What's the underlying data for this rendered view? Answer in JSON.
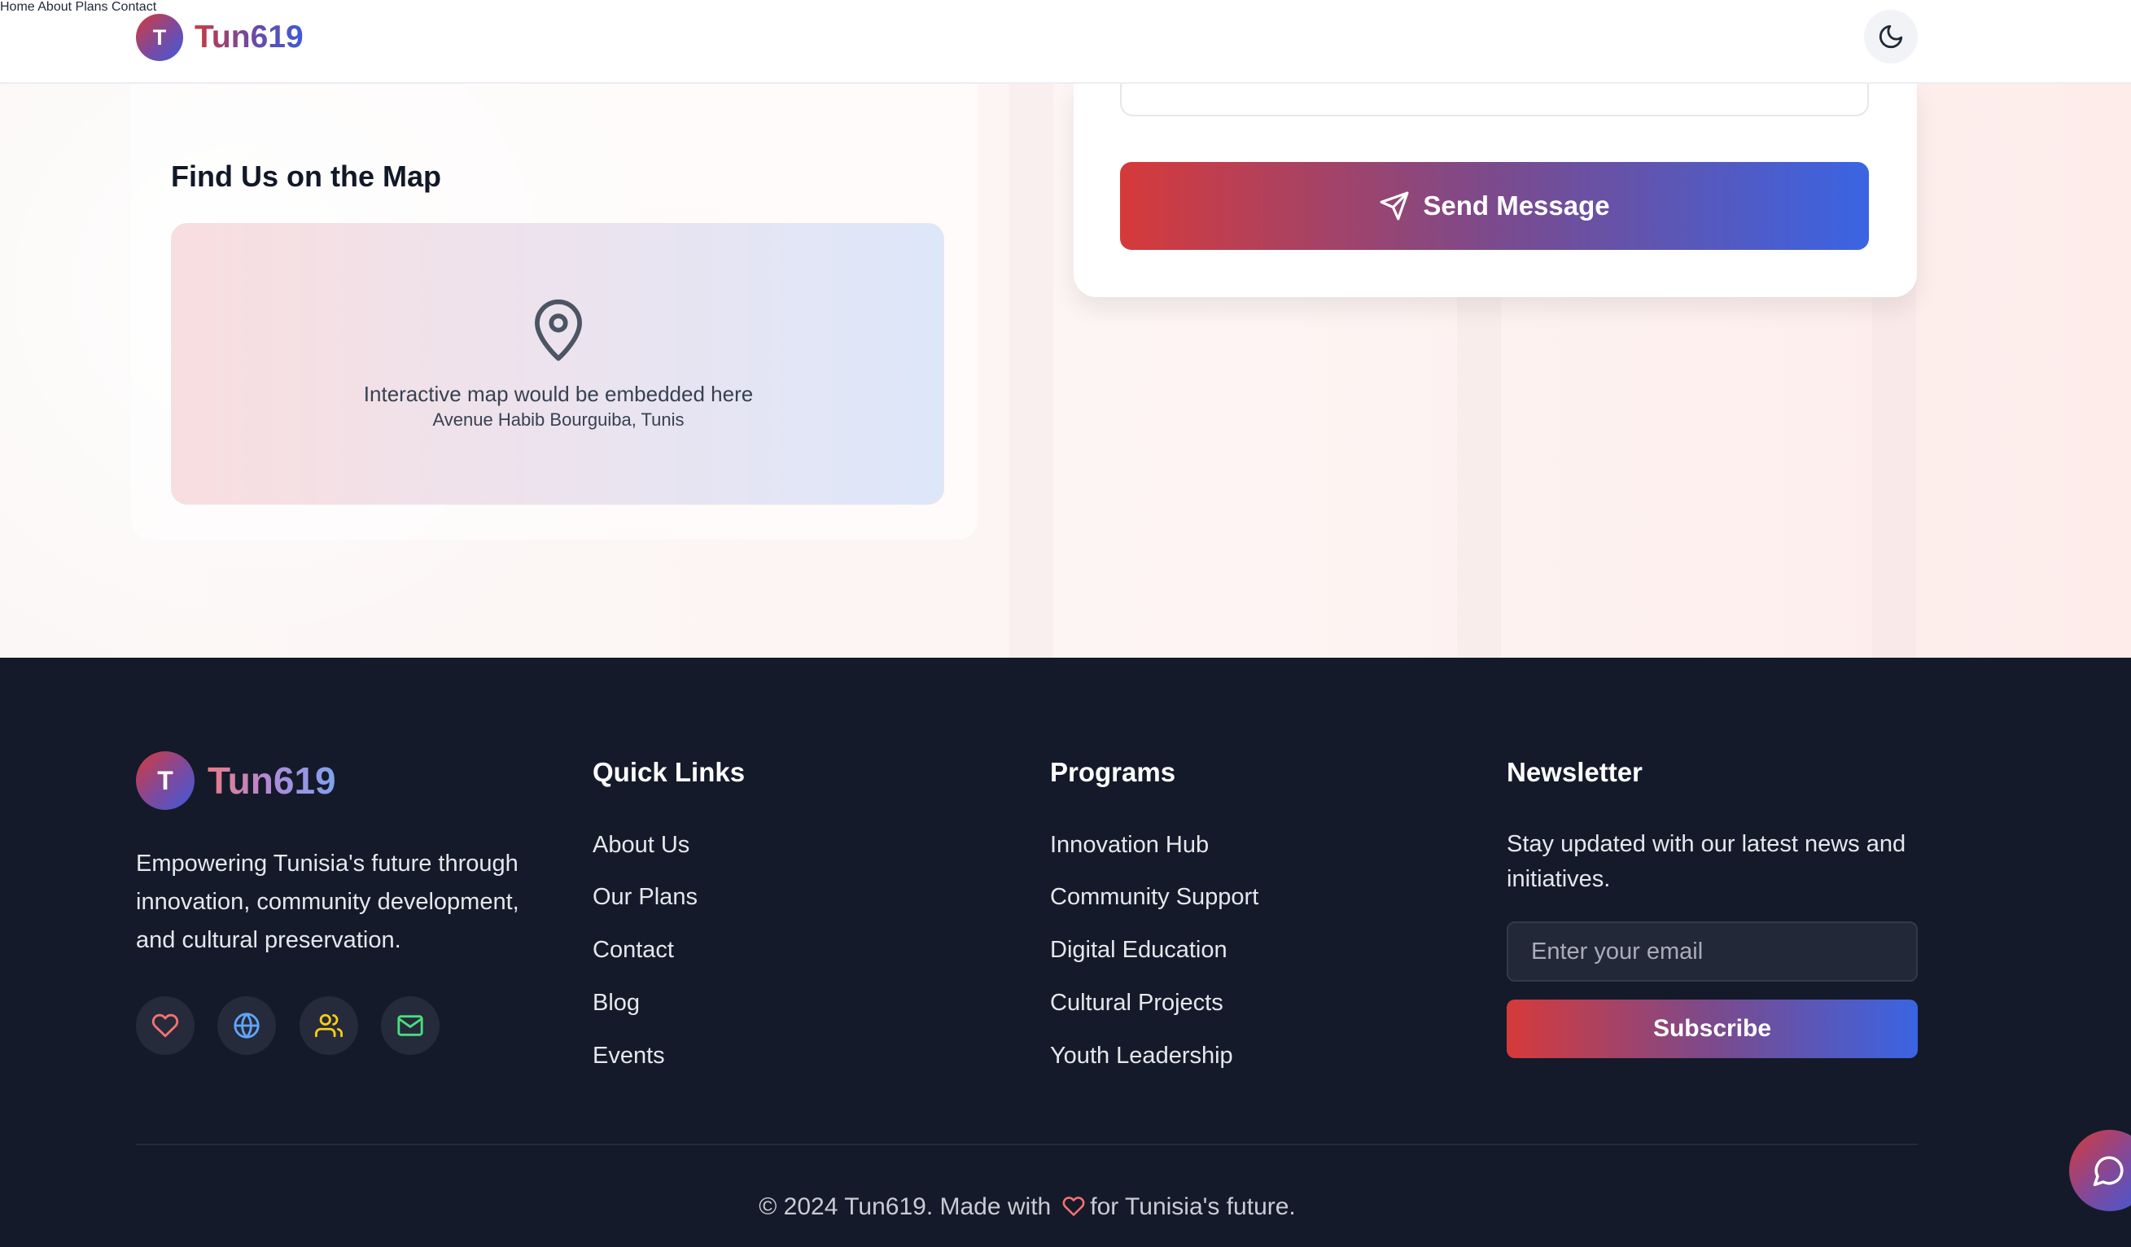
{
  "header": {
    "logo_letter": "T",
    "brand": "Tun619",
    "nav": [
      {
        "label": "Home"
      },
      {
        "label": "About"
      },
      {
        "label": "Plans"
      },
      {
        "label": "Contact"
      }
    ],
    "theme_toggle_icon": "moon-icon"
  },
  "map_section": {
    "heading": "Find Us on the Map",
    "pin_icon": "map-pin-icon",
    "placeholder_text": "Interactive map would be embedded here",
    "address": "Avenue Habib Bourguiba, Tunis"
  },
  "contact_form": {
    "send_label": "Send Message",
    "send_icon": "paper-plane-icon"
  },
  "footer": {
    "logo_letter": "T",
    "brand": "Tun619",
    "description": "Empowering Tunisia's future through innovation, community development, and cultural preservation.",
    "social": [
      {
        "icon": "heart-icon",
        "color": "#f87171"
      },
      {
        "icon": "globe-icon",
        "color": "#60a5fa"
      },
      {
        "icon": "users-icon",
        "color": "#facc15"
      },
      {
        "icon": "mail-icon",
        "color": "#4ade80"
      }
    ],
    "quick_links": {
      "title": "Quick Links",
      "items": [
        "About Us",
        "Our Plans",
        "Contact",
        "Blog",
        "Events"
      ]
    },
    "programs": {
      "title": "Programs",
      "items": [
        "Innovation Hub",
        "Community Support",
        "Digital Education",
        "Cultural Projects",
        "Youth Leadership"
      ]
    },
    "newsletter": {
      "title": "Newsletter",
      "text": "Stay updated with our latest news and initiatives.",
      "placeholder": "Enter your email",
      "button": "Subscribe"
    },
    "copyright_before": "© 2024 Tun619. Made with",
    "copyright_after": "for Tunisia's future."
  },
  "chat_widget_icon": "chat-bubble-icon",
  "colors": {
    "accent_red": "#d63a3a",
    "accent_blue": "#3a64e3",
    "footer_bg": "#141a2a"
  }
}
